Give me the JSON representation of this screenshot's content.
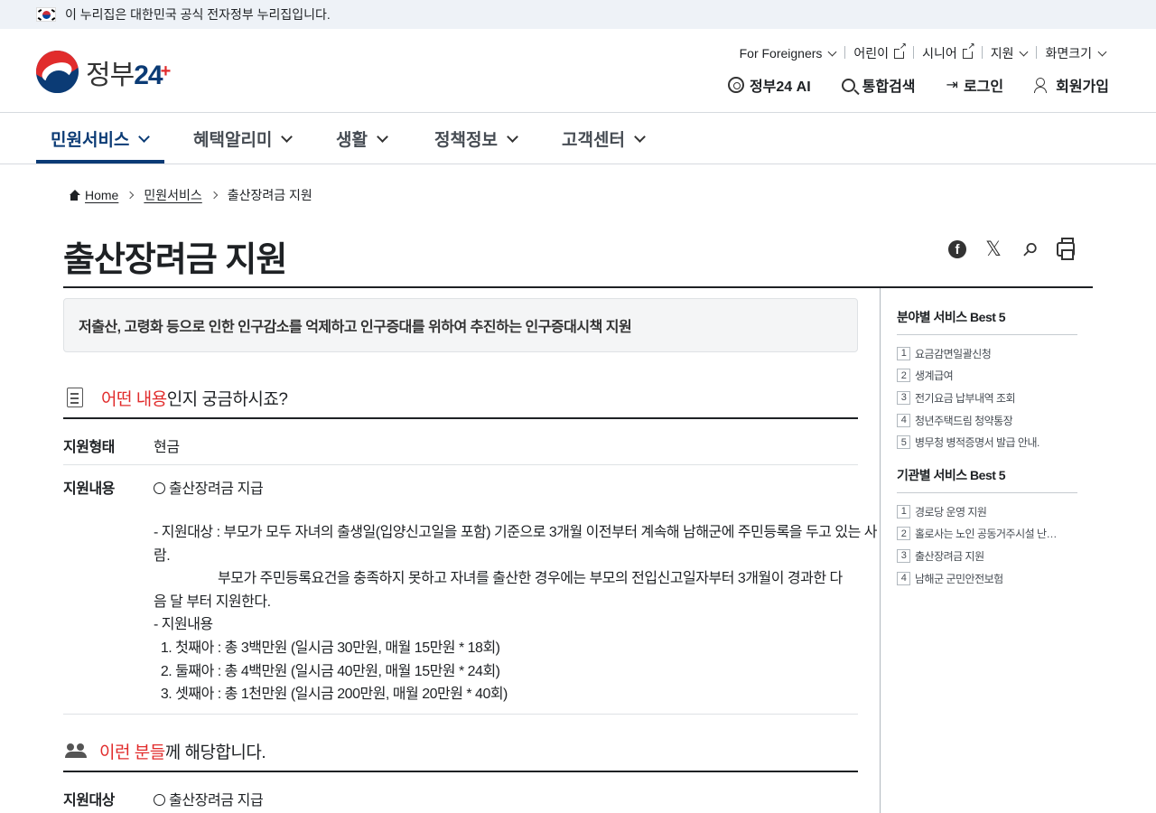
{
  "banner": {
    "text": "이 누리집은 대한민국 공식 전자정부 누리집입니다."
  },
  "logo": {
    "text": "정부",
    "number": "24",
    "plus": "+"
  },
  "util_nav": [
    {
      "label": "For Foreigners",
      "type": "dropdown"
    },
    {
      "label": "어린이",
      "type": "external"
    },
    {
      "label": "시니어",
      "type": "external"
    },
    {
      "label": "지원",
      "type": "dropdown"
    },
    {
      "label": "화면크기",
      "type": "dropdown"
    }
  ],
  "main_util": {
    "ai": "정부24 AI",
    "search": "통합검색",
    "login": "로그인",
    "signup": "회원가입"
  },
  "gnb": [
    {
      "label": "민원서비스",
      "active": true
    },
    {
      "label": "혜택알리미",
      "active": false
    },
    {
      "label": "생활",
      "active": false
    },
    {
      "label": "정책정보",
      "active": false
    },
    {
      "label": "고객센터",
      "active": false
    }
  ],
  "breadcrumb": {
    "home": "Home",
    "level1": "민원서비스",
    "current": "출산장려금 지원"
  },
  "page_title": "출산장려금 지원",
  "share_icons": [
    "facebook-icon",
    "x-icon",
    "link-clip-icon",
    "print-icon"
  ],
  "summary": "저출산, 고령화 등으로 인한 인구감소를 억제하고 인구증대를 위하여 추진하는 인구증대시책 지원",
  "section1": {
    "highlight": "어떤 내용",
    "rest": "인지 궁금하시죠?",
    "rows": [
      {
        "label": "지원형태",
        "value": "현금"
      },
      {
        "label": "지원내용",
        "value": "출산장려금 지급"
      }
    ],
    "content_lines": [
      "- 지원대상 : 부모가 모두 자녀의 출생일(입양신고일을 포함) 기준으로 3개월 이전부터 계속해 남해군에 주민등록을 두고 있는 사",
      "람.",
      "                  부모가 주민등록요건을 충족하지 못하고 자녀를 출산한 경우에는 부모의 전입신고일자부터 3개월이 경과한 다",
      "음 달 부터 지원한다.",
      "- 지원내용",
      "  1. 첫째아 : 총 3백만원 (일시금 30만원, 매월 15만원 * 18회)",
      "  2. 둘째아 : 총 4백만원 (일시금 40만원, 매월 15만원 * 24회)",
      "  3. 셋째아 : 총 1천만원 (일시금 200만원, 매월 20만원 * 40회)"
    ]
  },
  "section2": {
    "highlight": "이런 분들",
    "rest": "께 해당합니다.",
    "rows": [
      {
        "label": "지원대상",
        "value": "출산장려금 지급"
      }
    ]
  },
  "side": {
    "field_best": {
      "title": "분야별 서비스 Best 5",
      "items": [
        {
          "num": "1",
          "label": "요금감면일괄신청"
        },
        {
          "num": "2",
          "label": "생계급여"
        },
        {
          "num": "3",
          "label": "전기요금 납부내역 조회"
        },
        {
          "num": "4",
          "label": "청년주택드림 청약통장"
        },
        {
          "num": "5",
          "label": "병무청 병적증명서 발급 안내."
        }
      ]
    },
    "agency_best": {
      "title": "기관별 서비스 Best 5",
      "items": [
        {
          "num": "1",
          "label": "경로당 운영 지원"
        },
        {
          "num": "2",
          "label": "홀로사는 노인 공동거주시설 난…"
        },
        {
          "num": "3",
          "label": "출산장려금 지원"
        },
        {
          "num": "4",
          "label": "남해군 군민안전보험"
        }
      ]
    }
  },
  "colors": {
    "brand_navy": "#0b3b75",
    "accent_red": "#e12c2c",
    "banner_bg": "#eef2f7"
  }
}
